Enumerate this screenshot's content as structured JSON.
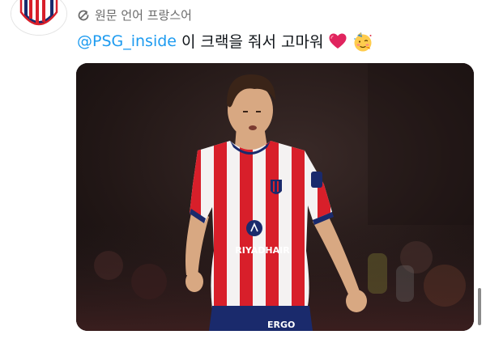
{
  "post": {
    "translate_label": "원문 언어 프랑스어",
    "mention": "@PSG_inside",
    "message": "이 크랙을 줘서 고마워",
    "emojis": [
      "red-heart",
      "partying-face"
    ]
  },
  "media": {
    "jersey_sponsor": "RIYADHAIR",
    "shorts_sponsor": "ERGO"
  },
  "colors": {
    "mention": "#1d9bf0",
    "jersey_red": "#d81f2a",
    "jersey_navy": "#1a2a6c"
  }
}
